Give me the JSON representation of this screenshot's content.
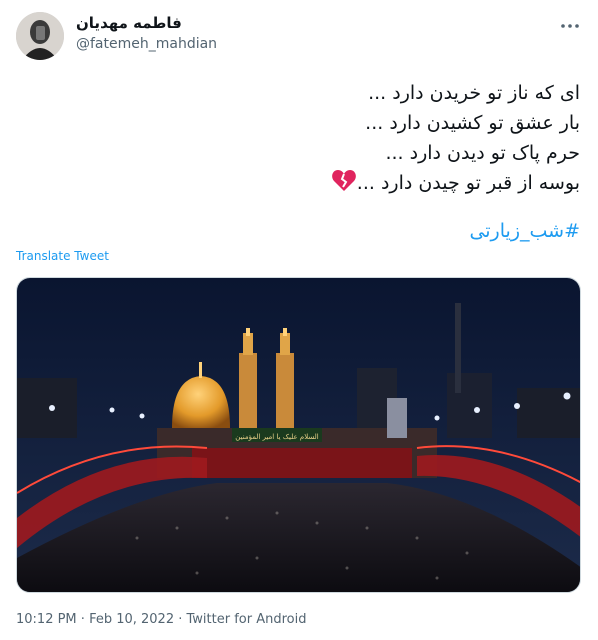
{
  "author": {
    "display_name": "فاطمه مهدیان",
    "handle": "@fatemeh_mahdian"
  },
  "tweet": {
    "lines": [
      "ای که ناز تو خریدن دارد ...",
      "بار عشق تو کشیدن دارد ...",
      "حرم پاک تو دیدن دارد ...",
      "بوسه از قبر تو چیدن دارد ..."
    ],
    "emoji": "broken-heart-icon",
    "hashtag": "#شب_زیارتی"
  },
  "translate_label": "Translate Tweet",
  "photo": {
    "banner_text": "السلام علیک یا امیر المؤمنین"
  },
  "footer": {
    "time": "10:12 PM",
    "separator1": " · ",
    "date": "Feb 10, 2022",
    "separator2": " · ",
    "source": "Twitter for Android"
  },
  "colors": {
    "link": "#1d9bf0",
    "secondary_text": "#536471",
    "heart": "#e0245e"
  }
}
